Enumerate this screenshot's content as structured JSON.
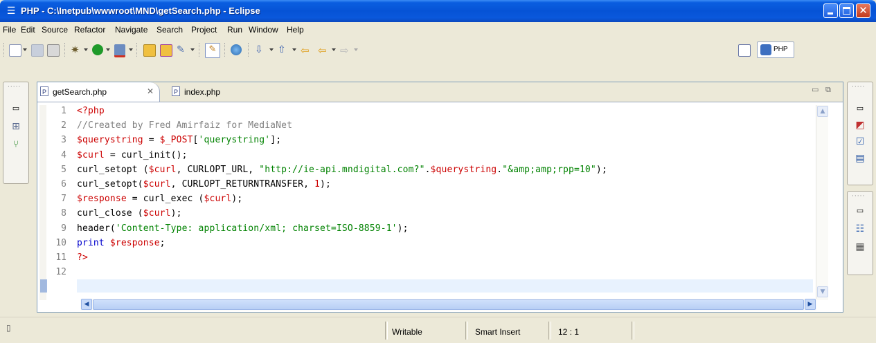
{
  "window": {
    "title": "PHP - C:\\Inetpub\\wwwroot\\MND\\getSearch.php - Eclipse"
  },
  "menu": [
    "File",
    "Edit",
    "Source",
    "Refactor",
    "Navigate",
    "Search",
    "Project",
    "Run",
    "Window",
    "Help"
  ],
  "perspective": {
    "label": "PHP"
  },
  "tabs": [
    {
      "label": "getSearch.php",
      "active": true
    },
    {
      "label": "index.php",
      "active": false
    }
  ],
  "editor": {
    "line_numbers": [
      "1",
      "2",
      "3",
      "4",
      "5",
      "6",
      "7",
      "8",
      "9",
      "10",
      "11",
      "12"
    ],
    "lines": [
      [
        [
          "k",
          "<?php"
        ]
      ],
      [
        [
          "c",
          "//Created by Fred Amirfaiz for MediaNet"
        ]
      ],
      [
        [
          "v",
          "$querystring"
        ],
        [
          "p",
          " = "
        ],
        [
          "v",
          "$_POST"
        ],
        [
          "p",
          "["
        ],
        [
          "s",
          "'querystring'"
        ],
        [
          "p",
          "];"
        ]
      ],
      [
        [
          "v",
          "$curl"
        ],
        [
          "p",
          " = curl_init();"
        ]
      ],
      [
        [
          "p",
          "curl_setopt ("
        ],
        [
          "v",
          "$curl"
        ],
        [
          "p",
          ", CURLOPT_URL, "
        ],
        [
          "s",
          "\"http://ie-api.mndigital.com?\""
        ],
        [
          "p",
          "."
        ],
        [
          "v",
          "$querystring"
        ],
        [
          "p",
          "."
        ],
        [
          "s",
          "\"&amp;amp;rpp=10\""
        ],
        [
          "p",
          ");"
        ]
      ],
      [
        [
          "p",
          "curl_setopt("
        ],
        [
          "v",
          "$curl"
        ],
        [
          "p",
          ", CURLOPT_RETURNTRANSFER, "
        ],
        [
          "n",
          "1"
        ],
        [
          "p",
          ");"
        ]
      ],
      [
        [
          "v",
          "$response"
        ],
        [
          "p",
          " = curl_exec ("
        ],
        [
          "v",
          "$curl"
        ],
        [
          "p",
          ");"
        ]
      ],
      [
        [
          "p",
          "curl_close ("
        ],
        [
          "v",
          "$curl"
        ],
        [
          "p",
          ");"
        ]
      ],
      [
        [
          "p",
          "header("
        ],
        [
          "s",
          "'Content-Type: application/xml; charset=ISO-8859-1'"
        ],
        [
          "p",
          ");"
        ]
      ],
      [
        [
          "b",
          "print"
        ],
        [
          "p",
          " "
        ],
        [
          "v",
          "$response"
        ],
        [
          "p",
          ";"
        ]
      ],
      [
        [
          "k",
          "?>"
        ]
      ],
      []
    ]
  },
  "status": {
    "writable": "Writable",
    "insert_mode": "Smart Insert",
    "position": "12 : 1"
  },
  "colors": {
    "titlebar": "#0653d6",
    "php_tag": "#cc0000",
    "comment": "#808080",
    "string": "#008200",
    "keyword": "#0000cc",
    "current_line": "#e8f2fe"
  }
}
